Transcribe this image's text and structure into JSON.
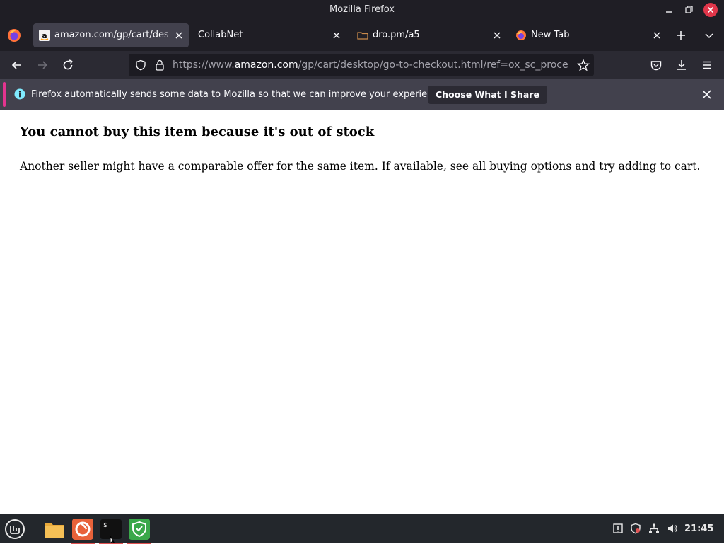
{
  "window": {
    "title": "Mozilla Firefox"
  },
  "tabs": [
    {
      "label": "amazon.com/gp/cart/desktop/go-to-checkout.html",
      "favicon": "amazon-icon",
      "active": true
    },
    {
      "label": "CollabNet",
      "favicon": null,
      "active": false
    },
    {
      "label": "dro.pm/a5",
      "favicon": "folder-icon",
      "active": false
    },
    {
      "label": "New Tab",
      "favicon": "firefox-icon",
      "active": false
    }
  ],
  "urlbar": {
    "prefix": "https://www.",
    "host": "amazon.com",
    "path": "/gp/cart/desktop/go-to-checkout.html/ref=ox_sc_proceed?oldc"
  },
  "notification": {
    "message": "Firefox automatically sends some data to Mozilla so that we can improve your experience.",
    "button_label": "Choose What I Share"
  },
  "page": {
    "heading": "You cannot buy this item because it's out of stock",
    "body": "Another seller might have a comparable offer for the same item. If available, see all buying options and try adding to cart."
  },
  "taskbar": {
    "apps": [
      "mint-menu-icon",
      "files-icon",
      "firefox-icon",
      "terminal-icon",
      "shield-app-icon"
    ],
    "clock": "21:45"
  },
  "colors": {
    "chrome_dark": "#1f1e25",
    "toolbar": "#2b2a33",
    "notification": "#42414d",
    "notification_accent": "#e3348f",
    "close_red": "#e0364a"
  }
}
